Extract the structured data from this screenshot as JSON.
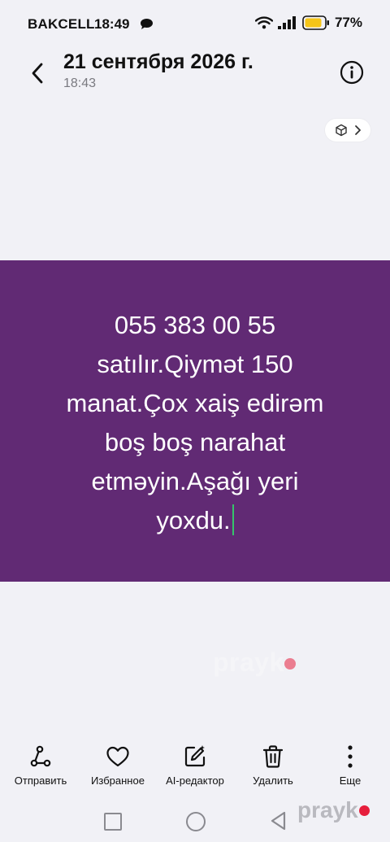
{
  "status_bar": {
    "carrier": "BAKCELL",
    "time": "18:49",
    "battery": "77%"
  },
  "header": {
    "title": "21 сентября 2026 г.",
    "subtitle": "18:43"
  },
  "image": {
    "caption": "055 383 00 55\nsatılır.Qiymət 150\nmanat.Çox xaiş edirəm\nboş boş narahat\netməyin.Aşağı yeri\nyoxdu.",
    "background_color": "#612a74",
    "watermark": "prayk"
  },
  "toolbar": {
    "share_label": "Отправить",
    "favorite_label": "Избранное",
    "ai_editor_label": "AI-редактор",
    "delete_label": "Удалить",
    "more_label": "Еще"
  },
  "watermark": {
    "text": "prayk"
  }
}
